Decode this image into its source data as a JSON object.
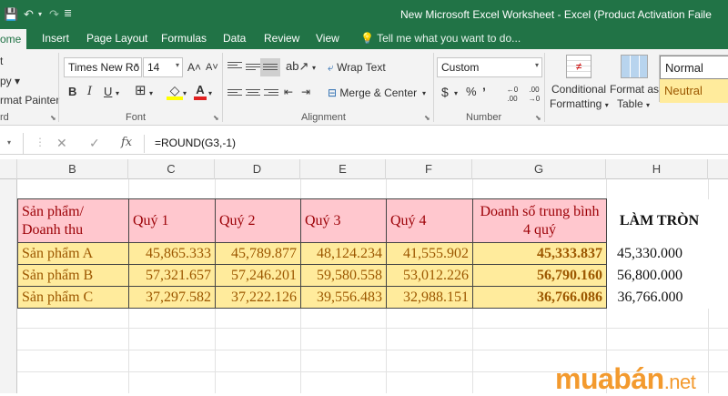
{
  "window": {
    "title": "New Microsoft Excel Worksheet - Excel (Product Activation Faile",
    "qa_save": "💾",
    "qa_undo": "↶",
    "qa_redo": "↷",
    "qa_more": "≣"
  },
  "ribbon_tabs": [
    "ome",
    "Insert",
    "Page Layout",
    "Formulas",
    "Data",
    "Review",
    "View"
  ],
  "tell_me": "Tell me what you want to do...",
  "clipboard": {
    "cut": "t",
    "copy": "py ▾",
    "format_painter": "rmat Painter",
    "group": "rd"
  },
  "font": {
    "name": "Times New Ro",
    "size": "14",
    "bold": "B",
    "italic": "I",
    "underline": "U",
    "group": "Font",
    "grow": "A˄",
    "shrink": "A˅"
  },
  "alignment": {
    "wrap": "Wrap Text",
    "merge": "Merge & Center",
    "group": "Alignment"
  },
  "number": {
    "format": "Custom",
    "currency": "$",
    "percent": "%",
    "comma": "’",
    "inc_dec": ".0→.00",
    "dec_dec": ".00→.0",
    "group": "Number"
  },
  "styles": {
    "conditional": "Conditional",
    "formatting": "Formatting",
    "format_as": "Format as",
    "table": "Table",
    "normal": "Normal",
    "neutral": "Neutral"
  },
  "formula_bar": {
    "cancel": "✕",
    "enter": "✓",
    "fx": "fx",
    "formula": "=ROUND(G3,-1)"
  },
  "columns": [
    "B",
    "C",
    "D",
    "E",
    "F",
    "G",
    "H"
  ],
  "table": {
    "headers": [
      "Sản phẩm/\nDoanh thu",
      "Quý 1",
      "Quý 2",
      "Quý 3",
      "Quý 4",
      "Doanh số trung bình 4 quý",
      "LÀM TRÒN"
    ],
    "rows": [
      {
        "product": "Sản phẩm A",
        "q1": "45,865.333",
        "q2": "45,789.877",
        "q3": "48,124.234",
        "q4": "41,555.902",
        "avg": "45,333.837",
        "round": "45,330.000"
      },
      {
        "product": "Sản phẩm B",
        "q1": "57,321.657",
        "q2": "57,246.201",
        "q3": "59,580.558",
        "q4": "53,012.226",
        "avg": "56,790.160",
        "round": "56,800.000"
      },
      {
        "product": "Sản phẩm C",
        "q1": "37,297.582",
        "q2": "37,222.126",
        "q3": "39,556.483",
        "q4": "32,988.151",
        "avg": "36,766.086",
        "round": "36,766.000"
      }
    ]
  },
  "watermark": {
    "brand": "muabán",
    "tld": ".net"
  },
  "colors": {
    "excel_green": "#217346",
    "bad_fill": "#ffc7ce",
    "neutral_fill": "#ffeb9c",
    "watermark": "#f39a2e"
  }
}
